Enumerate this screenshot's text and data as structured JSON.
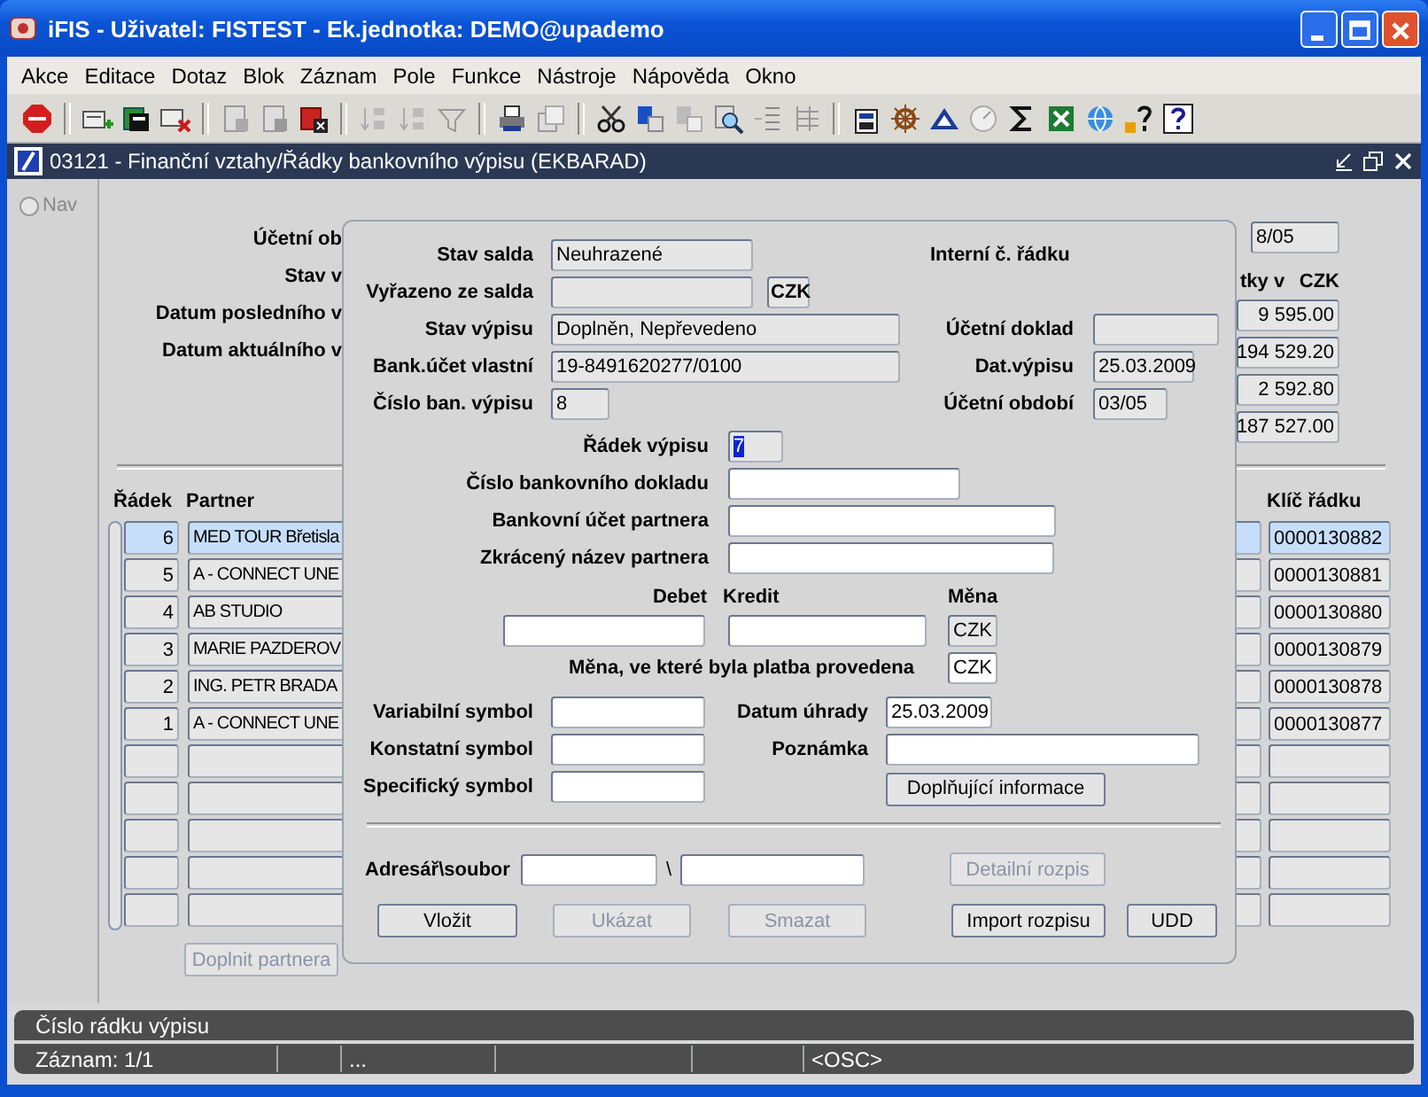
{
  "window": {
    "title": "iFIS - Uživatel: FISTEST - Ek.jednotka: DEMO@upademo"
  },
  "menu": [
    "Akce",
    "Editace",
    "Dotaz",
    "Blok",
    "Záznam",
    "Pole",
    "Funkce",
    "Nástroje",
    "Nápověda",
    "Okno"
  ],
  "form": {
    "title": "03121 - Finanční vztahy/Řádky bankovního výpisu (EKBARAD)"
  },
  "nav": {
    "label": "Nav",
    "selected": false
  },
  "header": {
    "labels": [
      "Účetní ob",
      "Stav v",
      "Datum posledního v",
      "Datum aktuálního v"
    ],
    "period": "8/05",
    "column_header": "tky v",
    "currency": "CZK",
    "amounts": [
      "9 595.00",
      "194 529.20",
      "2 592.80",
      "187 527.00"
    ]
  },
  "table": {
    "columns": [
      "Řádek",
      "Partner",
      "Klíč řádku"
    ],
    "rows": [
      {
        "radek": "6",
        "partner": "MED TOUR Břetisla",
        "klic": "0000130882",
        "selected": true
      },
      {
        "radek": "5",
        "partner": "A - CONNECT UNE",
        "klic": "0000130881",
        "selected": false
      },
      {
        "radek": "4",
        "partner": "AB STUDIO",
        "klic": "0000130880",
        "selected": false
      },
      {
        "radek": "3",
        "partner": "MARIE PAZDEROV",
        "klic": "0000130879",
        "selected": false
      },
      {
        "radek": "2",
        "partner": "ING. PETR BRADA",
        "klic": "0000130878",
        "selected": false
      },
      {
        "radek": "1",
        "partner": "A - CONNECT UNE",
        "klic": "0000130877",
        "selected": false
      }
    ]
  },
  "partner_button": {
    "label": "Doplnit partnera",
    "disabled": true
  },
  "dialog": {
    "stav_salda": {
      "label": "Stav salda",
      "value": "Neuhrazené",
      "editable": false
    },
    "interni_radek": {
      "label": "Interní č. řádku"
    },
    "vyrazeno": {
      "label": "Vyřazeno ze salda",
      "editable": false,
      "currency": "CZK"
    },
    "stav_vypisu": {
      "label": "Stav výpisu",
      "value": "Doplněn, Nepřevedeno",
      "editable": false
    },
    "ucetni_doklad": {
      "label": "Účetní doklad",
      "editable": false
    },
    "bank_ucet": {
      "label": "Bank.účet vlastní",
      "value": "19-8491620277/0100",
      "editable": false
    },
    "dat_vypisu": {
      "label": "Dat.výpisu",
      "value": "25.03.2009",
      "editable": false
    },
    "cislo_vypisu": {
      "label": "Číslo ban. výpisu",
      "value": "8",
      "editable": false
    },
    "ucetni_obdobi": {
      "label": "Účetní období",
      "value": "03/05",
      "editable": false
    },
    "radek_vypisu": {
      "label": "Řádek výpisu",
      "value": "7",
      "editable": false,
      "selected": true
    },
    "cislo_dokladu": {
      "label": "Číslo bankovního dokladu",
      "editable": true
    },
    "ucet_partnera": {
      "label": "Bankovní účet partnera",
      "editable": true
    },
    "nazev_partnera": {
      "label": "Zkrácený název partnera",
      "editable": true
    },
    "debet": {
      "label": "Debet",
      "editable": true
    },
    "kredit": {
      "label": "Kredit",
      "editable": true
    },
    "mena": {
      "label": "Měna",
      "value": "CZK",
      "editable": false
    },
    "mena_platby": {
      "label": "Měna, ve které byla platba provedena",
      "value": "CZK",
      "editable": true
    },
    "variabilni": {
      "label": "Variabilní symbol",
      "editable": true
    },
    "datum_uhrady": {
      "label": "Datum úhrady",
      "value": "25.03.2009",
      "editable": true
    },
    "konstantni": {
      "label": "Konstatní symbol",
      "editable": true
    },
    "poznamka": {
      "label": "Poznámka",
      "editable": true
    },
    "specificky": {
      "label": "Specifický symbol",
      "editable": true
    },
    "doplnujici": {
      "label": "Doplňující informace",
      "disabled": false
    },
    "adresar": {
      "label": "Adresář\\soubor",
      "separator": "\\",
      "editable": true
    },
    "detailni": {
      "label": "Detailní rozpis",
      "disabled": true
    },
    "buttons": [
      {
        "label": "Vložit",
        "disabled": false
      },
      {
        "label": "Ukázat",
        "disabled": true
      },
      {
        "label": "Smazat",
        "disabled": true
      },
      {
        "label": "Import rozpisu",
        "disabled": false
      },
      {
        "label": "UDD",
        "disabled": false
      }
    ]
  },
  "status": {
    "hint": "Číslo rádku výpisu",
    "record": "Záznam: 1/1",
    "indicator": "...",
    "mode": "<OSC>"
  }
}
